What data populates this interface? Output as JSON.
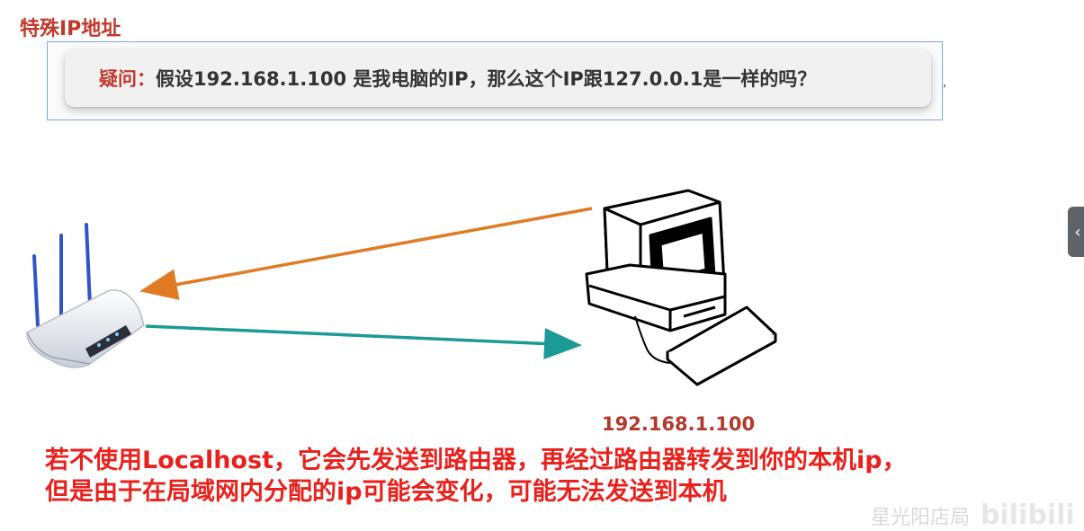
{
  "title": "特殊IP地址",
  "question": {
    "label": "疑问：",
    "text": "假设192.168.1.100 是我电脑的IP，那么这个IP跟127.0.0.1是一样的吗？"
  },
  "diagram": {
    "router_icon": "wifi-router-icon",
    "computer_icon": "desktop-computer-icon",
    "arrow_to_router_color": "#e07b24",
    "arrow_to_computer_color": "#1b9a96",
    "computer_ip": "192.168.1.100"
  },
  "explanation": {
    "line1": "若不使用Localhost，它会先发送到路由器，再经过路由器转发到你的本机ip，",
    "line2": "但是由于在局域网内分配的ip可能会变化，可能无法发送到本机"
  },
  "watermark": {
    "text": "星光阳店局",
    "logo": "bilibili"
  },
  "side_tab_icon": "chevron-left-icon"
}
